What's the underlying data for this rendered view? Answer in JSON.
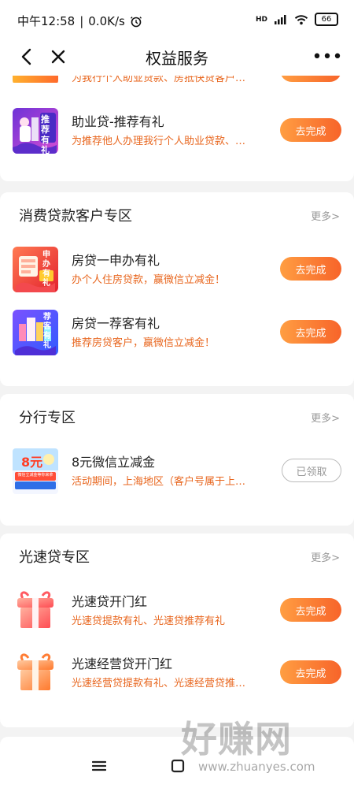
{
  "status_bar": {
    "time": "中午12:58",
    "network_speed": "0.0K/s",
    "alarm_icon": "alarm-icon",
    "hd_label": "HD",
    "signal_icon": "signal-icon",
    "wifi_icon": "wifi-icon",
    "battery": "66"
  },
  "nav": {
    "title": "权益服务",
    "back_icon": "back-icon",
    "close_icon": "close-icon",
    "more_label": "•••"
  },
  "top_partial": {
    "desc": "为我行个人助业贷款、房抵快贷客户…"
  },
  "section_top": {
    "items": [
      {
        "title": "助业贷-推荐有礼",
        "desc": "为推荐他人办理我行个人助业贷款、…",
        "button": "去完成",
        "thumb_label": "推荐有礼"
      }
    ]
  },
  "sections": [
    {
      "title": "消费贷款客户专区",
      "more": "更多>",
      "items": [
        {
          "title": "房贷一申办有礼",
          "desc": "办个人住房贷款，赢微信立减金！",
          "button": "去完成",
          "thumb_label": "申办有礼"
        },
        {
          "title": "房贷一荐客有礼",
          "desc": "推荐房贷客户，赢微信立减金！",
          "button": "去完成",
          "thumb_label": "荐客有礼"
        }
      ]
    },
    {
      "title": "分行专区",
      "more": "更多>",
      "items": [
        {
          "title": "8元微信立减金",
          "desc": "活动期间，上海地区（客户号属于上…",
          "button": "已领取",
          "thumb_label": "8元",
          "thumb_sub": "微信立减金等你来拿"
        }
      ]
    },
    {
      "title": "光速贷专区",
      "more": "更多>",
      "items": [
        {
          "title": "光速贷开门红",
          "desc": "光速贷提款有礼、光速贷推荐有礼",
          "button": "去完成"
        },
        {
          "title": "光速经营贷开门红",
          "desc": "光速经营贷提款有礼、光速经营贷推…",
          "button": "去完成"
        }
      ]
    }
  ],
  "bottom_nav": {
    "menu_icon": "menu-icon",
    "home_icon": "home-icon"
  },
  "watermark": {
    "text": "好赚网",
    "url": "www.zhuanyes.com"
  },
  "colors": {
    "accent": "#f7642a",
    "desc_text": "#e8661e",
    "background": "#f3f3f3"
  }
}
